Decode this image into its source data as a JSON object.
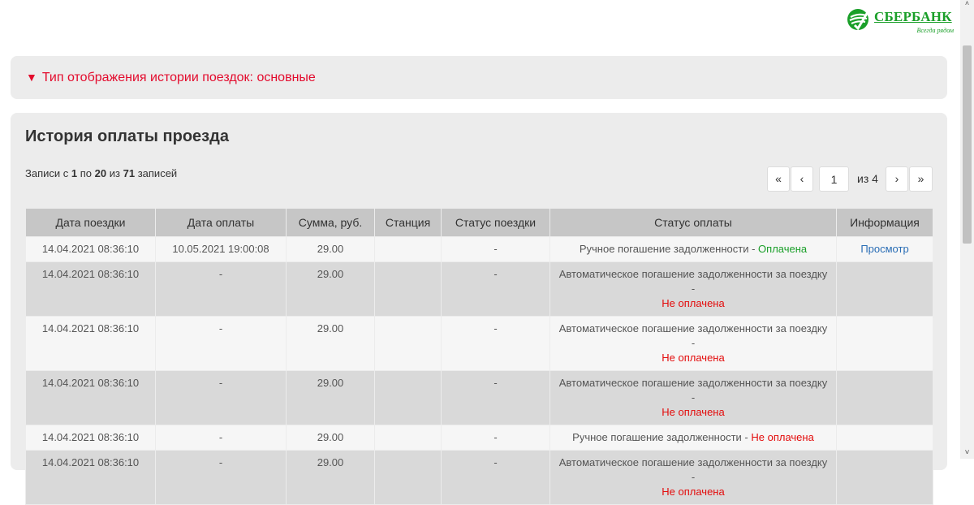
{
  "brand": {
    "name": "СБЕРБАНК",
    "slogan": "Всегда рядом",
    "color": "#1a9f29"
  },
  "display_toggle": {
    "arrow": "▼",
    "label": "Тип отображения истории поездок: основные",
    "color": "#e30b2d"
  },
  "history": {
    "title": "История оплаты проезда",
    "records": {
      "prefix": "Записи с",
      "from": "1",
      "mid1": "по",
      "to": "20",
      "mid2": "из",
      "total": "71",
      "suffix": "записей"
    },
    "pager": {
      "first": "«",
      "prev": "‹",
      "current_page": "1",
      "of_label": "из 4",
      "next": "›",
      "last": "»"
    },
    "columns": [
      "Дата поездки",
      "Дата оплаты",
      "Сумма, руб.",
      "Станция",
      "Статус поездки",
      "Статус оплаты",
      "Информация"
    ],
    "rows": [
      {
        "trip_date": "14.04.2021 08:36:10",
        "payment_date": "10.05.2021 19:00:08",
        "amount": "29.00",
        "station": "",
        "trip_status": "-",
        "payment_status_text": "Ручное погашение задолженности -",
        "payment_status_value": "Оплачена",
        "info": "Просмотр"
      },
      {
        "trip_date": "14.04.2021 08:36:10",
        "payment_date": "-",
        "amount": "29.00",
        "station": "",
        "trip_status": "-",
        "payment_status_text": "Автоматическое погашение задолженности за поездку -",
        "payment_status_value": "Не оплачена",
        "info": ""
      },
      {
        "trip_date": "14.04.2021 08:36:10",
        "payment_date": "-",
        "amount": "29.00",
        "station": "",
        "trip_status": "-",
        "payment_status_text": "Автоматическое погашение задолженности за поездку -",
        "payment_status_value": "Не оплачена",
        "info": ""
      },
      {
        "trip_date": "14.04.2021 08:36:10",
        "payment_date": "-",
        "amount": "29.00",
        "station": "",
        "trip_status": "-",
        "payment_status_text": "Автоматическое погашение задолженности за поездку -",
        "payment_status_value": "Не оплачена",
        "info": ""
      },
      {
        "trip_date": "14.04.2021 08:36:10",
        "payment_date": "-",
        "amount": "29.00",
        "station": "",
        "trip_status": "-",
        "payment_status_text": "Ручное погашение задолженности -",
        "payment_status_value": "Не оплачена",
        "info": ""
      },
      {
        "trip_date": "14.04.2021 08:36:10",
        "payment_date": "-",
        "amount": "29.00",
        "station": "",
        "trip_status": "-",
        "payment_status_text": "Автоматическое погашение задолженности за поездку -",
        "payment_status_value": "Не оплачена",
        "info": ""
      }
    ]
  },
  "colors": {
    "paid": "#1a9f29",
    "unpaid": "#e30b0b",
    "link": "#2a6db5",
    "panel_bg": "#ececec",
    "header_bg": "#c6c6c6"
  },
  "icons": {
    "logo": "sberbank-logo-icon",
    "toggle": "triangle-down-icon",
    "scroll_up": "chevron-up-icon",
    "scroll_down": "chevron-down-icon"
  }
}
